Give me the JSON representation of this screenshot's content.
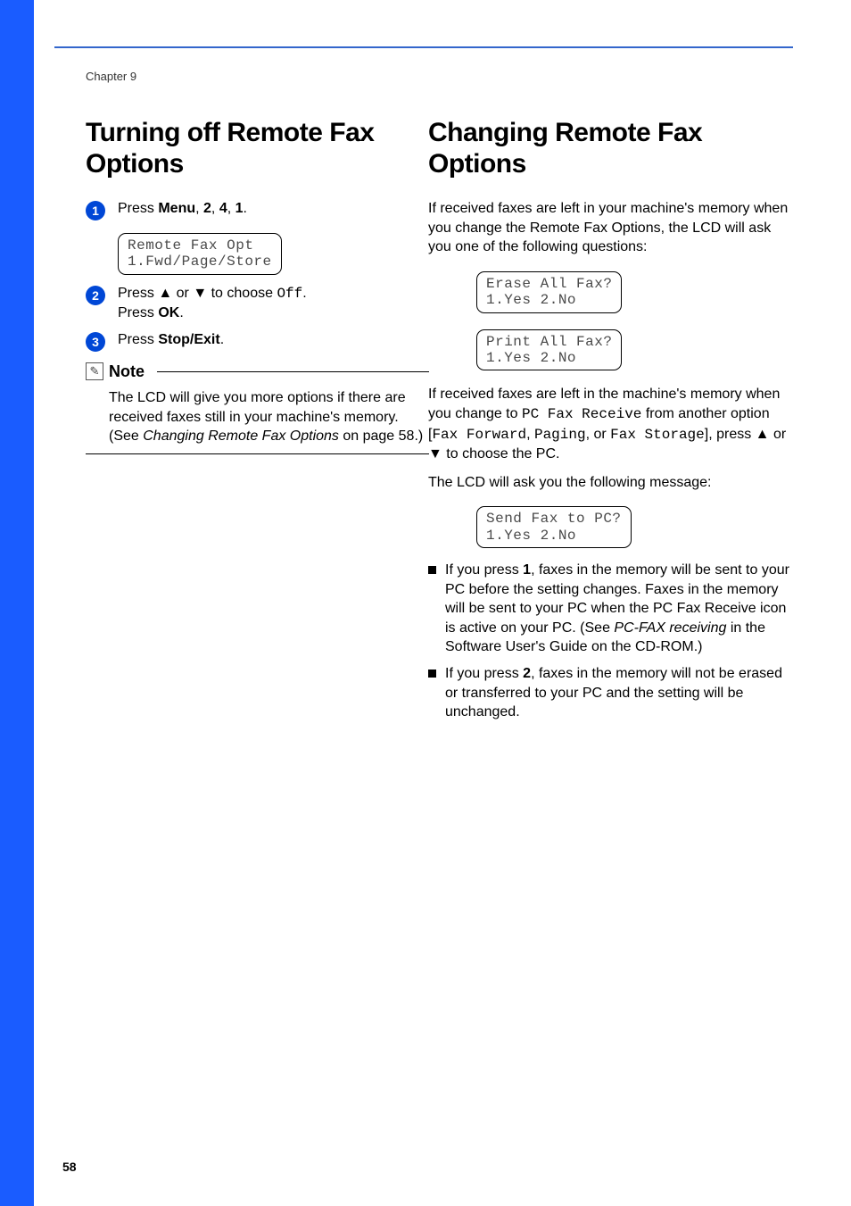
{
  "chapter": "Chapter 9",
  "pageNumber": "58",
  "left": {
    "heading": "Turning off Remote Fax Options",
    "step1": {
      "num": "1",
      "pre": "Press ",
      "b1": "Menu",
      "c1": ", ",
      "b2": "2",
      "c2": ", ",
      "b3": "4",
      "c3": ", ",
      "b4": "1",
      "c4": "."
    },
    "lcd1": "Remote Fax Opt\n1.Fwd/Page/Store",
    "step2": {
      "num": "2",
      "l1a": "Press ",
      "l1up": "▲",
      "l1mid": " or ",
      "l1down": "▼",
      "l1b": " to choose ",
      "off": "Off",
      "l1c": ".",
      "l2a": "Press ",
      "ok": "OK",
      "l2b": "."
    },
    "step3": {
      "num": "3",
      "a": "Press ",
      "b": "Stop/Exit",
      "c": "."
    },
    "noteTitle": "Note",
    "noteBody": {
      "a": "The LCD will give you more options if there are received faxes still in your machine's memory. (See ",
      "i": "Changing Remote Fax Options",
      "b": " on page 58.)"
    }
  },
  "right": {
    "heading": "Changing Remote Fax Options",
    "p1": "If received faxes are left in your machine's memory when you change the Remote Fax Options, the LCD will ask you one of the following questions:",
    "lcdA": "Erase All Fax?\n1.Yes 2.No",
    "lcdB": "Print All Fax?\n1.Yes 2.No",
    "p2": {
      "a": "If received faxes are left in the machine's memory when you change to ",
      "m1": "PC Fax Receive",
      "b": " from another option [",
      "m2": "Fax Forward",
      "c": ", ",
      "m3": "Paging",
      "d": ", or ",
      "m4": "Fax Storage",
      "e": "], press ",
      "up": "▲",
      "mid": " or ",
      "down": "▼",
      "f": " to choose the PC."
    },
    "p3": "The LCD will ask you the following message:",
    "lcdC": "Send Fax to PC?\n1.Yes 2.No",
    "b1": {
      "a": "If you press ",
      "key": "1",
      "b": ", faxes in the memory will be sent to your PC before the setting changes. Faxes in the memory will be sent to your PC when the PC Fax Receive icon is active on your PC. (See ",
      "i": "PC-FAX receiving",
      "c": " in the Software User's Guide on the CD-ROM.)"
    },
    "b2": {
      "a": "If you press ",
      "key": "2",
      "b": ", faxes in the memory will not be erased or transferred to your PC and the setting will be unchanged."
    }
  }
}
